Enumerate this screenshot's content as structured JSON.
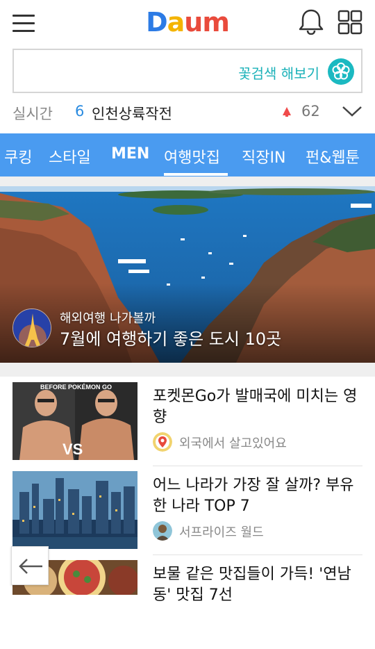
{
  "header": {
    "logo_letters": [
      "D",
      "a",
      "u",
      "m"
    ],
    "logo_colors": [
      "#2c7be5",
      "#f4b400",
      "#e94b3c",
      "#e94b3c"
    ],
    "menu_icon": "hamburger-icon",
    "notification_icon": "bell-icon",
    "apps_icon": "grid-icon"
  },
  "search": {
    "placeholder": "꽃검색 해보기",
    "button_icon": "flower-icon"
  },
  "realtime": {
    "label": "실시간",
    "rank": "6",
    "term": "인천상륙작전",
    "trend": "up",
    "count": "62"
  },
  "tabs": [
    {
      "label": "쿠킹"
    },
    {
      "label": "스타일"
    },
    {
      "label": "MEN"
    },
    {
      "label": "여행맛집"
    },
    {
      "label": "직장IN"
    },
    {
      "label": "펀&웹툰"
    }
  ],
  "active_tab": "여행맛집",
  "hero": {
    "category": "해외여행 나가볼까",
    "title": "7월에 여행하기 좋은 도시 10곳"
  },
  "articles": [
    {
      "title": "포켓몬Go가 발매국에 미치는 영향",
      "source": "외국에서 살고있어요",
      "thumb_caption": "BEFORE POKÉMON GO",
      "thumb_badge": "VS"
    },
    {
      "title": "어느 나라가 가장 잘 살까? 부유한 나라 TOP 7",
      "source": "서프라이즈 월드"
    },
    {
      "title": "보물 같은 맛집들이 가득! '연남동' 맛집 7선",
      "source": ""
    }
  ],
  "colors": {
    "accent": "#4a9bf0",
    "search_accent": "#1ab1b8",
    "trend_up": "#f04b4b"
  }
}
